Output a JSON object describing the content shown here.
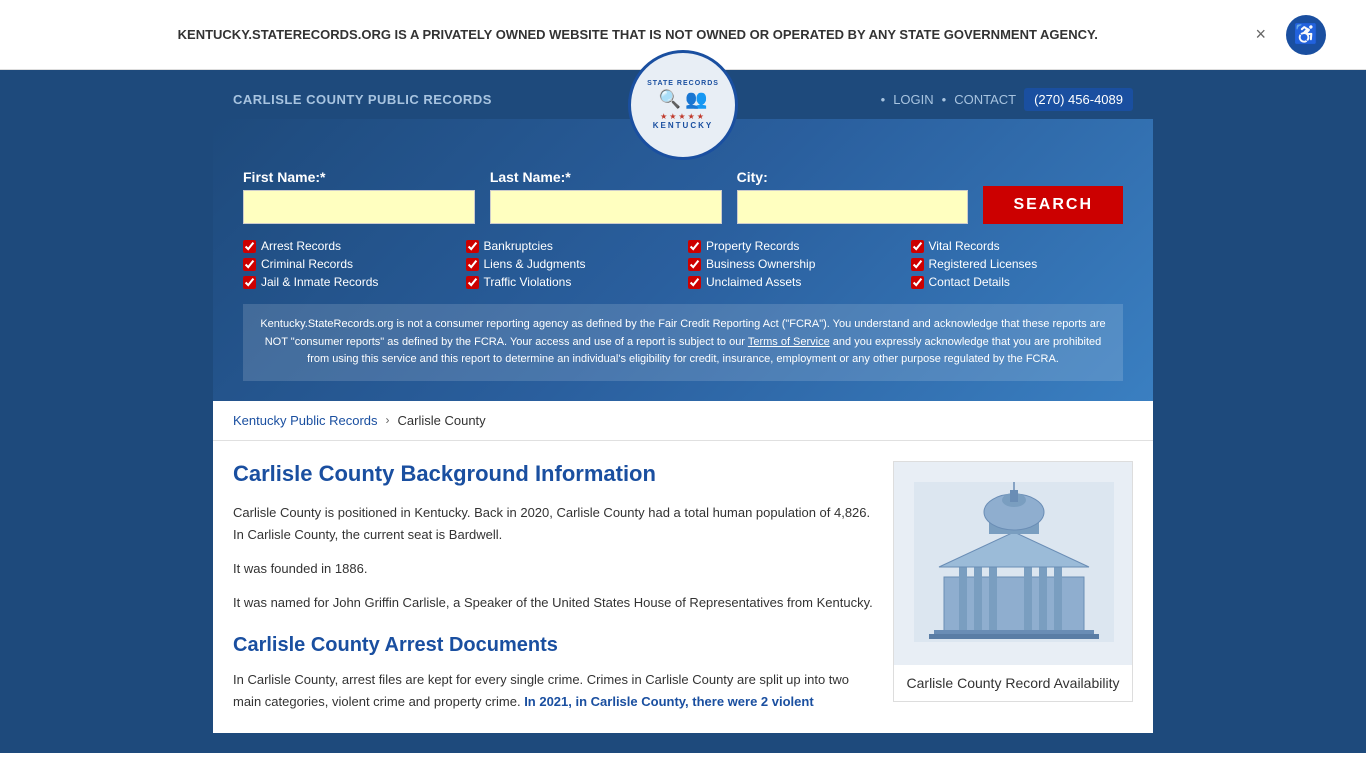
{
  "banner": {
    "text": "KENTUCKY.STATERECORDS.ORG IS A PRIVATELY OWNED WEBSITE THAT IS NOT OWNED OR OPERATED BY ANY STATE GOVERNMENT AGENCY.",
    "close_label": "×"
  },
  "accessibility": {
    "icon": "♿"
  },
  "nav": {
    "site_title": "CARLISLE COUNTY PUBLIC RECORDS",
    "login_label": "LOGIN",
    "contact_label": "CONTACT",
    "phone": "(270) 456-4089",
    "dot": "•"
  },
  "search": {
    "first_name_label": "First Name:*",
    "last_name_label": "Last Name:*",
    "city_label": "City:",
    "button_label": "SEARCH"
  },
  "checkboxes": [
    {
      "label": "Arrest Records",
      "checked": true
    },
    {
      "label": "Bankruptcies",
      "checked": true
    },
    {
      "label": "Property Records",
      "checked": true
    },
    {
      "label": "Vital Records",
      "checked": true
    },
    {
      "label": "Criminal Records",
      "checked": true
    },
    {
      "label": "Liens & Judgments",
      "checked": true
    },
    {
      "label": "Business Ownership",
      "checked": true
    },
    {
      "label": "Registered Licenses",
      "checked": true
    },
    {
      "label": "Jail & Inmate Records",
      "checked": true
    },
    {
      "label": "Traffic Violations",
      "checked": true
    },
    {
      "label": "Unclaimed Assets",
      "checked": true
    },
    {
      "label": "Contact Details",
      "checked": true
    }
  ],
  "disclaimer": {
    "text_before": "Kentucky.StateRecords.org is not a consumer reporting agency as defined by the Fair Credit Reporting Act (\"FCRA\"). You understand and acknowledge that these reports are NOT \"consumer reports\" as defined by the FCRA. Your access and use of a report is subject to our ",
    "tos_link": "Terms of Service",
    "text_after": " and you expressly acknowledge that you are prohibited from using this service and this report to determine an individual's eligibility for credit, insurance, employment or any other purpose regulated by the FCRA."
  },
  "breadcrumb": {
    "parent_label": "Kentucky Public Records",
    "current_label": "Carlisle County"
  },
  "main": {
    "heading": "Carlisle County Background Information",
    "intro_text": "Carlisle County is positioned in Kentucky. Back in 2020, Carlisle County had a total human population of 4,826. In Carlisle County, the current seat is Bardwell.",
    "founded_text": "It was founded in 1886.",
    "named_text": "It was named for John Griffin Carlisle, a Speaker of the United States House of Representatives from Kentucky.",
    "arrest_heading": "Carlisle County Arrest Documents",
    "arrest_text": "In Carlisle County, arrest files are kept for every single crime. Crimes in Carlisle County are split up into two main categories, violent crime and property crime. In 2021, in Carlisle County, there were 2 violent",
    "arrest_highlight": "In 2021, in Carlisle County, there were 2 violent"
  },
  "sidebar": {
    "label": "Carlisle County Record Availability"
  }
}
